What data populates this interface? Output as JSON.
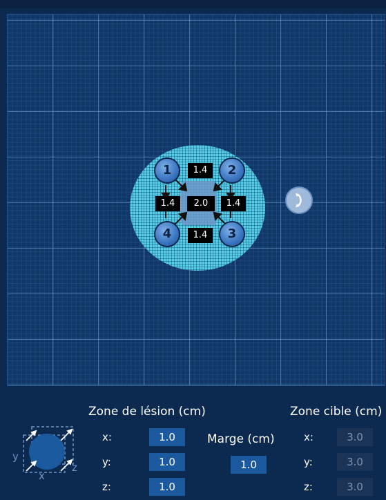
{
  "points": [
    {
      "id": "1"
    },
    {
      "id": "2"
    },
    {
      "id": "3"
    },
    {
      "id": "4"
    }
  ],
  "distances": {
    "top": "1.4",
    "left": "1.4",
    "center": "2.0",
    "right": "1.4",
    "bottom": "1.4"
  },
  "lesion_zone": {
    "title": "Zone de lésion (cm)",
    "x_label": "x:",
    "y_label": "y:",
    "z_label": "z:",
    "x": "1.0",
    "y": "1.0",
    "z": "1.0"
  },
  "margin": {
    "title": "Marge (cm)",
    "value": "1.0"
  },
  "target_zone": {
    "title": "Zone cible (cm)",
    "x_label": "x:",
    "y_label": "y:",
    "z_label": "z:",
    "x": "3.0",
    "y": "3.0",
    "z": "3.0"
  },
  "axes_icon": {
    "x": "x",
    "y": "y",
    "z": "z"
  },
  "colors": {
    "background": "#0c2a4f",
    "grid": "#103766",
    "target_zone": "#4fd1e8",
    "value_box": "#1b5a9e"
  }
}
